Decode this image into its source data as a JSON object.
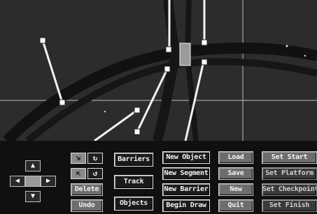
{
  "editor": {
    "mode_buttons": [
      "Barriers",
      "Track",
      "Objects"
    ],
    "new_buttons": [
      "New Object",
      "New Segment",
      "New Barrier",
      "Begin Draw"
    ],
    "file_buttons": [
      "Load",
      "Save",
      "New",
      "Quit"
    ],
    "set_buttons": [
      "Set Start",
      "Set Platform",
      "Set Checkpoint",
      "Set Finish"
    ],
    "tools": {
      "delete_label": "Delete",
      "undo_label": "Undo"
    },
    "nav_icons": [
      "arrow-up-icon",
      "arrow-left-icon",
      "center-icon",
      "arrow-right-icon",
      "arrow-down-icon"
    ],
    "tool_icons": [
      "expand-icon",
      "rotate-cw-icon",
      "collapse-icon",
      "rotate-ccw-icon"
    ]
  }
}
